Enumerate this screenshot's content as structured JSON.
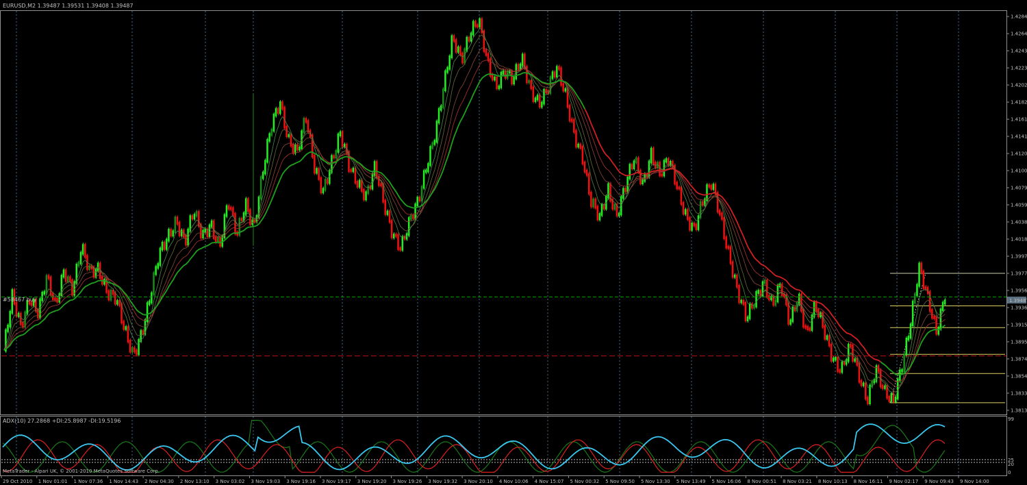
{
  "window": {
    "title": "EURUSD,M2  1.39487 1.39531 1.39408 1.39487"
  },
  "indicator": {
    "title": "ADX(10) 27.2868 +DI:25.8987 -DI:19.5196",
    "scale_labels": [
      "99",
      "25",
      "20",
      "0"
    ]
  },
  "order": {
    "label": "#58467 buy",
    "price_label": "1.39487"
  },
  "footer": {
    "copyright": "MetaTrader - Alpari UK, © 2001-2010 MetaQuotes Software Corp."
  },
  "colors": {
    "background": "#000000",
    "grid": "#4a6a8a",
    "bull_bright": "#22ee22",
    "bull_dark": "#1a8a1a",
    "bear": "#ee1111",
    "ma_slow": "#1fa01f",
    "ma_red": "#d02020",
    "fib": "#e0d060",
    "adx": "#3ac8f0",
    "plus_di": "#1a7a1a",
    "minus_di": "#e02020"
  },
  "chart_data": {
    "type": "renko-candlestick",
    "symbol": "EURUSD",
    "timeframe": "M2",
    "ohlc_header": {
      "open": 1.39487,
      "high": 1.39531,
      "low": 1.39408,
      "close": 1.39487
    },
    "ylim": [
      1.3808,
      1.4292
    ],
    "y_ticks": [
      "1.42845",
      "1.42640",
      "1.42435",
      "1.42230",
      "1.42025",
      "1.41820",
      "1.41615",
      "1.41410",
      "1.41205",
      "1.41000",
      "1.40795",
      "1.40590",
      "1.40385",
      "1.40180",
      "1.39975",
      "1.39770",
      "1.39565",
      "1.39360",
      "1.39155",
      "1.38950",
      "1.38745",
      "1.38540",
      "1.38335",
      "1.38130"
    ],
    "x_ticks": [
      "29 Oct 2010",
      "1 Nov 01:01",
      "1 Nov 07:36",
      "1 Nov 14:43",
      "2 Nov 04:30",
      "2 Nov 13:10",
      "3 Nov 03:02",
      "3 Nov 19:03",
      "3 Nov 19:16",
      "3 Nov 19:17",
      "3 Nov 19:20",
      "3 Nov 19:26",
      "3 Nov 19:32",
      "3 Nov 20:10",
      "4 Nov 10:06",
      "4 Nov 15:07",
      "5 Nov 00:32",
      "5 Nov 09:50",
      "5 Nov 13:30",
      "5 Nov 13:49",
      "5 Nov 16:06",
      "8 Nov 00:51",
      "8 Nov 03:21",
      "8 Nov 10:13",
      "8 Nov 16:11",
      "9 Nov 02:17",
      "9 Nov 09:43",
      "9 Nov 14:00"
    ],
    "price_path": [
      1.3885,
      1.3945,
      1.3912,
      1.3952,
      1.3932,
      1.3968,
      1.3935,
      1.3985,
      1.396,
      1.4005,
      1.3975,
      1.3985,
      1.3958,
      1.3945,
      1.3905,
      1.388,
      1.391,
      1.395,
      1.3995,
      1.402,
      1.4045,
      1.4015,
      1.4048,
      1.402,
      1.404,
      1.401,
      1.406,
      1.402,
      1.4065,
      1.4035,
      1.4095,
      1.415,
      1.4185,
      1.414,
      1.412,
      1.416,
      1.4105,
      1.408,
      1.411,
      1.414,
      1.4105,
      1.409,
      1.407,
      1.41,
      1.406,
      1.403,
      1.401,
      1.4035,
      1.406,
      1.411,
      1.415,
      1.42,
      1.4255,
      1.4235,
      1.427,
      1.428,
      1.4225,
      1.42,
      1.4225,
      1.421,
      1.423,
      1.4195,
      1.4185,
      1.42,
      1.422,
      1.419,
      1.415,
      1.412,
      1.406,
      1.404,
      1.408,
      1.405,
      1.408,
      1.411,
      1.4085,
      1.4125,
      1.4095,
      1.411,
      1.408,
      1.405,
      1.403,
      1.406,
      1.4085,
      1.405,
      1.4,
      1.395,
      1.392,
      1.395,
      1.397,
      1.3935,
      1.396,
      1.392,
      1.3955,
      1.39,
      1.3935,
      1.391,
      1.388,
      1.386,
      1.3885,
      1.3855,
      1.383,
      1.3865,
      1.383,
      1.382,
      1.387,
      1.392,
      1.398,
      1.3945,
      1.391,
      1.3955
    ],
    "fib_levels": [
      1.3977,
      1.3938,
      1.3912,
      1.388,
      1.3857,
      1.3822
    ],
    "order_price": 1.39487,
    "stop_price": 1.3878,
    "adx_scale": [
      0,
      99
    ],
    "adx_levels": [
      20,
      25
    ]
  }
}
